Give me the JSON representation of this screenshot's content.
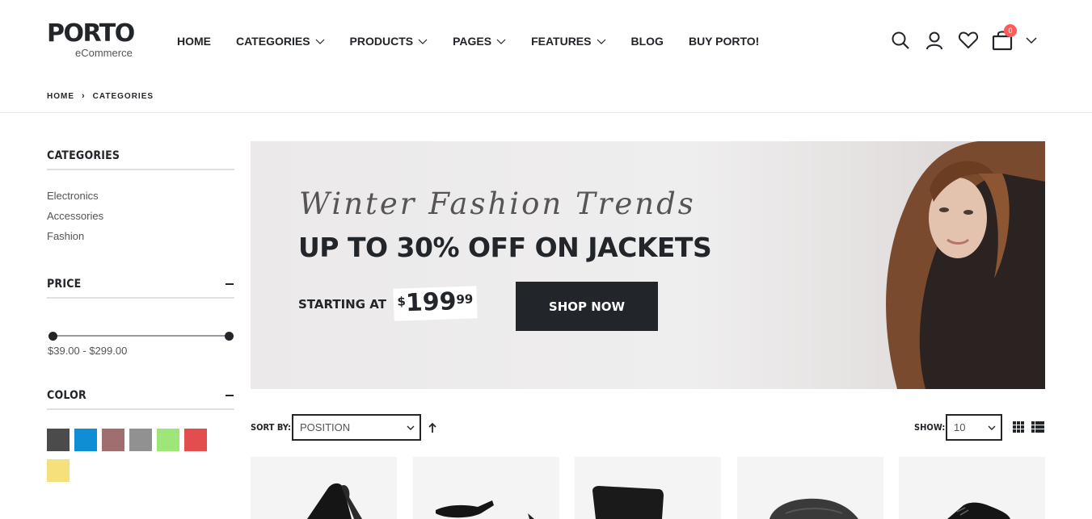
{
  "header": {
    "logo_main": "PORTO",
    "logo_sub": "eCommerce",
    "nav": [
      {
        "label": "HOME",
        "dropdown": false
      },
      {
        "label": "CATEGORIES",
        "dropdown": true
      },
      {
        "label": "PRODUCTS",
        "dropdown": true
      },
      {
        "label": "PAGES",
        "dropdown": true
      },
      {
        "label": "FEATURES",
        "dropdown": true
      },
      {
        "label": "BLOG",
        "dropdown": false
      },
      {
        "label": "BUY PORTO!",
        "dropdown": false
      }
    ],
    "icons": [
      "search-icon",
      "user-icon",
      "heart-icon",
      "cart-icon",
      "chevron-down-icon"
    ],
    "cart_count": "0"
  },
  "breadcrumb": {
    "items": [
      "HOME",
      "CATEGORIES"
    ]
  },
  "sidebar": {
    "categories_title": "CATEGORIES",
    "categories": [
      "Electronics",
      "Accessories",
      "Fashion"
    ],
    "price_title": "PRICE",
    "price_range": "$39.00 - $299.00",
    "color_title": "COLOR",
    "colors": [
      "#4b4b4b",
      "#0f8ed6",
      "#a06e6e",
      "#919191",
      "#9ee67a",
      "#e24e4e",
      "#f5e07c"
    ]
  },
  "banner": {
    "script_title": "Winter Fashion Trends",
    "headline": "UP TO 30% OFF ON JACKETS",
    "starting_at": "STARTING AT",
    "price_dollar": "$",
    "price_main": "199",
    "price_cents": "99",
    "cta": "SHOP NOW"
  },
  "toolbar": {
    "sort_label": "SORT BY:",
    "sort_value": "POSITION",
    "show_label": "SHOW:",
    "show_value": "10"
  },
  "colors": {
    "primary_dark": "#222529",
    "badge": "#ff5b5b",
    "product_bg": "#f4f4f4"
  }
}
